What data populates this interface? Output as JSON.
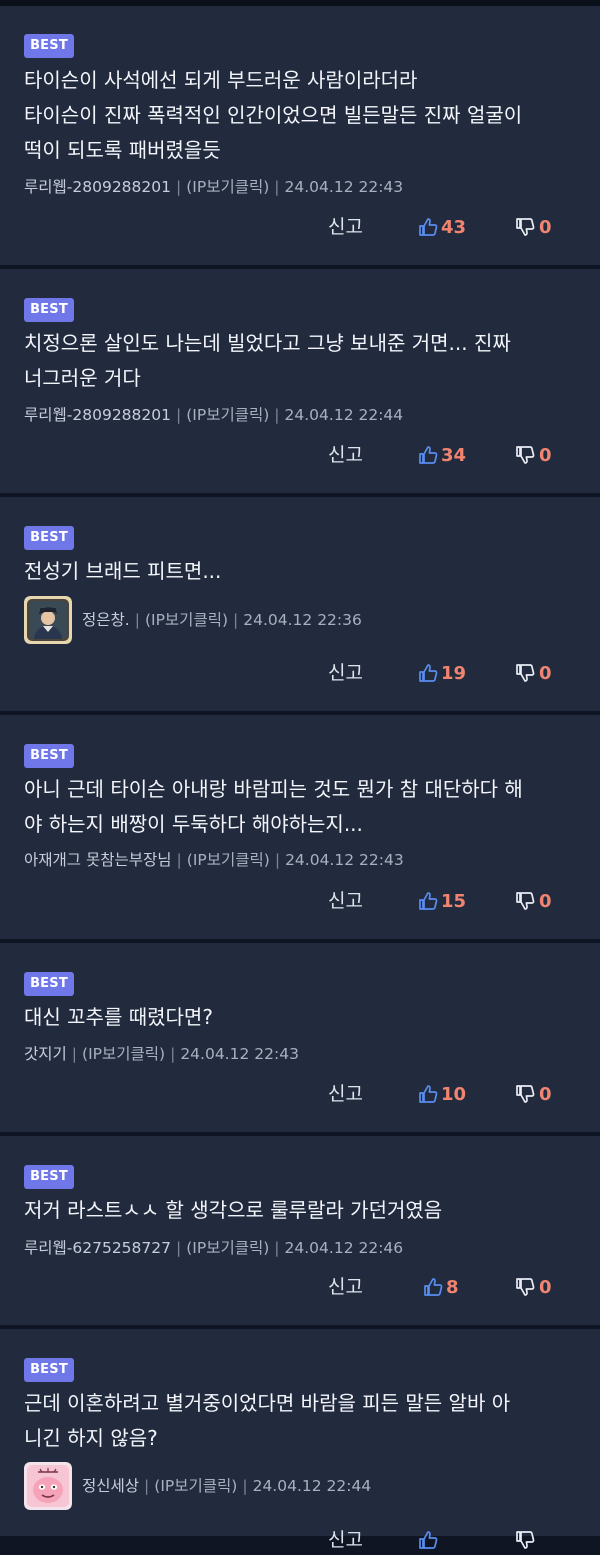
{
  "colors": {
    "background": "#0f1522",
    "card": "#222b3d",
    "badge": "#7078e9",
    "count": "#f08470",
    "like_icon": "#5a8df0",
    "meta_text": "#a8b0c0"
  },
  "labels": {
    "report": "신고",
    "ip_link": "(IP보기클릭)",
    "separator": "|"
  },
  "comments": [
    {
      "badge": "BEST",
      "lines": [
        "타이슨이 사석에선 되게 부드러운 사람이라더라",
        "타이슨이 진짜 폭력적인 인간이었으면 빌든말든 진짜 얼굴이",
        "떡이 되도록 패버렸을듯"
      ],
      "author": "루리웹-2809288201",
      "date": "24.04.12 22:43",
      "likes": "43",
      "dislikes": "0",
      "avatar": null
    },
    {
      "badge": "BEST",
      "lines": [
        "치정으론 살인도 나는데 빌었다고 그냥 보내준 거면... 진짜",
        "너그러운 거다"
      ],
      "author": "루리웹-2809288201",
      "date": "24.04.12 22:44",
      "likes": "34",
      "dislikes": "0",
      "avatar": null
    },
    {
      "badge": "BEST",
      "lines": [
        "전성기 브래드 피트면..."
      ],
      "author": "정은창.",
      "date": "24.04.12 22:36",
      "likes": "19",
      "dislikes": "0",
      "avatar": "character-avatar"
    },
    {
      "badge": "BEST",
      "lines": [
        "아니 근데 타이슨 아내랑 바람피는 것도 뭔가 참 대단하다 해",
        "야 하는지 배짱이 두둑하다 해야하는지..."
      ],
      "author": "아재개그 못참는부장님",
      "date": "24.04.12 22:43",
      "likes": "15",
      "dislikes": "0",
      "avatar": null
    },
    {
      "badge": "BEST",
      "lines": [
        "대신 꼬추를 때렸다면?"
      ],
      "author": "갓지기",
      "date": "24.04.12 22:43",
      "likes": "10",
      "dislikes": "0",
      "avatar": null
    },
    {
      "badge": "BEST",
      "lines": [
        "저거 라스트ㅅㅅ 할 생각으로 룰루랄라 가던거였음"
      ],
      "author": "루리웹-6275258727",
      "date": "24.04.12 22:46",
      "likes": "8",
      "dislikes": "0",
      "avatar": null
    },
    {
      "badge": "BEST",
      "lines": [
        "근데 이혼하려고 별거중이었다면 바람을 피든 말든 알바 아",
        "니긴 하지 않음?"
      ],
      "author": "정신세상",
      "date": "24.04.12 22:44",
      "likes": "",
      "dislikes": "",
      "avatar": "cartoon-face-avatar"
    }
  ]
}
